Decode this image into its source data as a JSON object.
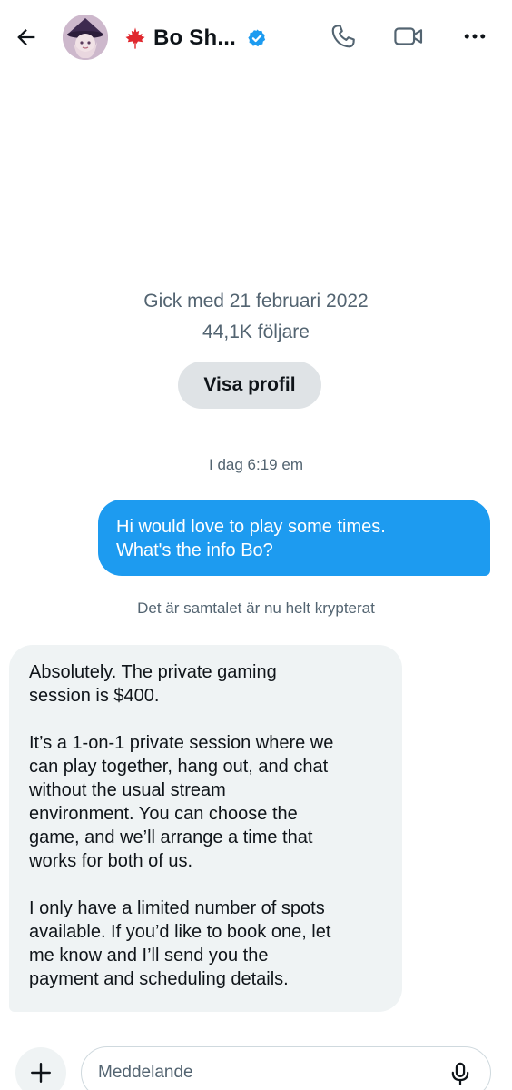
{
  "header": {
    "contact_name": "Bo Sh...",
    "back_icon": "arrow-left-icon",
    "call_icon": "phone-icon",
    "video_icon": "video-camera-icon",
    "more_icon": "more-horizontal-icon",
    "flag_icon": "maple-leaf-icon",
    "verified_icon": "verified-badge-icon"
  },
  "profile": {
    "joined": "Gick med 21 februari 2022",
    "followers": "44,1K följare",
    "view_profile_label": "Visa profil"
  },
  "conversation": {
    "timestamp": "I dag 6:19 em",
    "encrypted_notice": "Det är samtalet är nu helt krypterat",
    "outgoing": {
      "lines": [
        "Hi would love to play some times.",
        "What's the info Bo?"
      ]
    },
    "incoming": {
      "paragraphs": [
        [
          "Absolutely. The private gaming",
          "session is $400."
        ],
        [
          "It’s a 1-on-1 private session where we",
          "can play together, hang out, and chat",
          "without the usual stream",
          "environment. You can choose the",
          "game, and we’ll arrange a time that",
          "works for both of us."
        ],
        [
          "I only have a limited number of spots",
          "available. If you’d like to book one, let",
          "me know and I’ll send you the",
          "payment and scheduling details."
        ]
      ]
    }
  },
  "composer": {
    "placeholder": "Meddelande",
    "value": ""
  },
  "colors": {
    "accent": "#1d9bf0",
    "incoming_bubble": "#eff3f4",
    "muted_text": "#536471",
    "flag": "#e0282e"
  }
}
